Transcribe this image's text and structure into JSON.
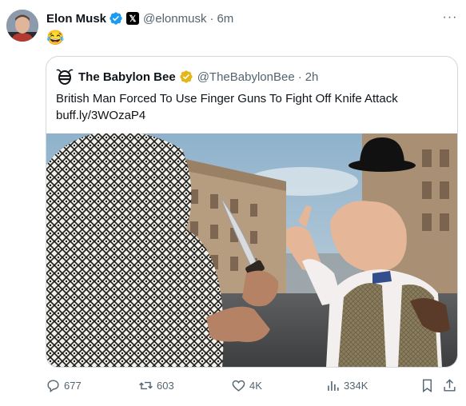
{
  "post": {
    "author_name": "Elon Musk",
    "x_badge": "𝕏",
    "handle": "@elonmusk",
    "separator": "·",
    "time": "6m",
    "text": "😂",
    "more": "···"
  },
  "quote": {
    "author_name": "The Babylon Bee",
    "handle": "@TheBabylonBee",
    "separator": "·",
    "time": "2h",
    "text": "British Man Forced To Use Finger Guns To Fight Off Knife Attack",
    "link": "buff.ly/3WOzaP4"
  },
  "actions": {
    "replies": "677",
    "reposts": "603",
    "likes": "4K",
    "views": "334K"
  },
  "colors": {
    "verified_blue": "#1d9bf0",
    "verified_gold": "#e2b719",
    "muted_text": "#536471",
    "border": "#cfd9de"
  },
  "icons": [
    "verified-icon",
    "x-badge-icon",
    "more-icon",
    "babylon-bee-logo",
    "gold-check-icon",
    "reply-icon",
    "repost-icon",
    "like-icon",
    "views-icon",
    "bookmark-icon",
    "share-icon"
  ]
}
